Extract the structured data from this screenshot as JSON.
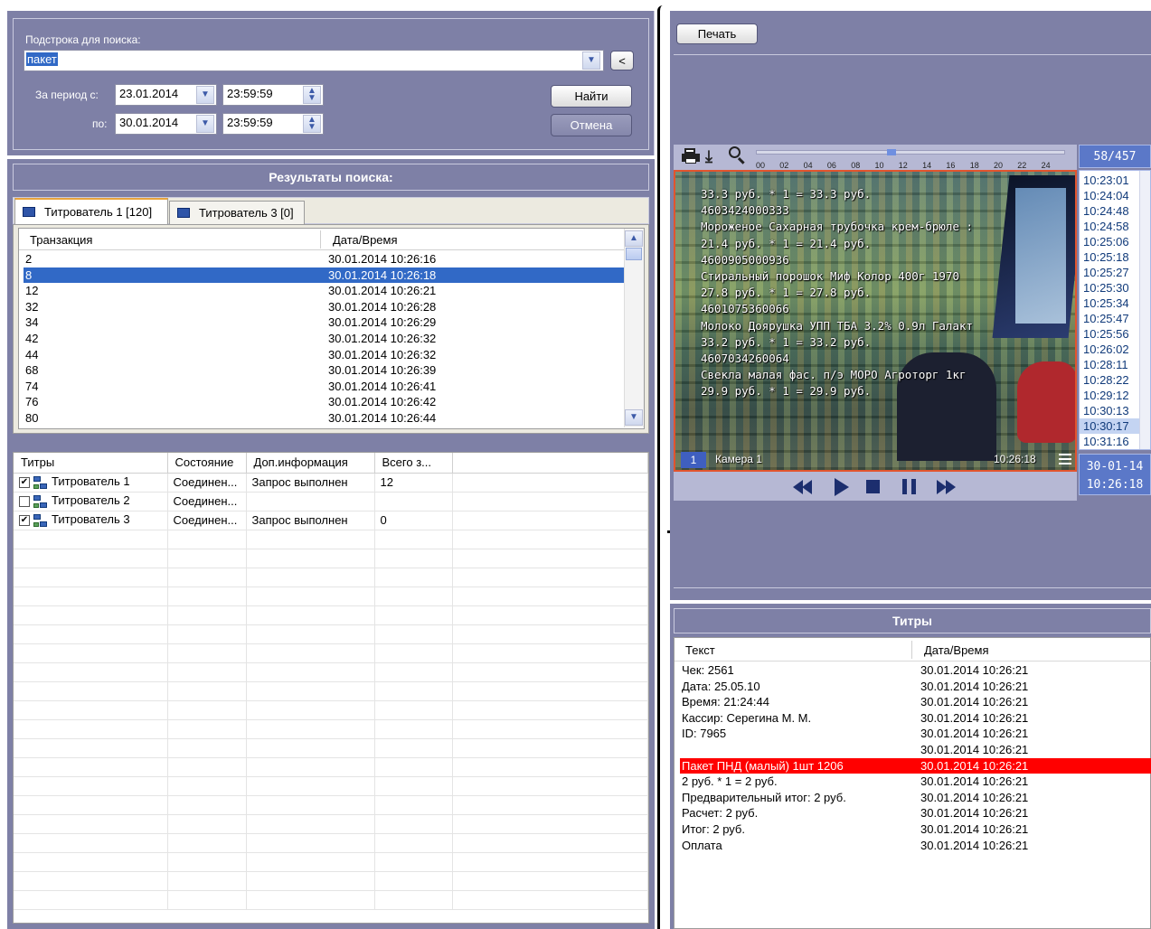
{
  "search": {
    "substring_label": "Подстрока для поиска:",
    "substring_value": "пакет",
    "back_symbol": "<",
    "period_from_label": "За период с:",
    "from_date": "23.01.2014",
    "from_time": "23:59:59",
    "period_to_label": "по:",
    "to_date": "30.01.2014",
    "to_time": "23:59:59",
    "find_label": "Найти",
    "cancel_label": "Отмена"
  },
  "results": {
    "header": "Результаты поиска:",
    "tabs": [
      {
        "label": "Титрователь 1 [120]"
      },
      {
        "label": "Титрователь 3 [0]"
      }
    ],
    "columns": [
      "Транзакция",
      "Дата/Время"
    ],
    "rows": [
      {
        "id": "2",
        "dt": "30.01.2014 10:26:16"
      },
      {
        "id": "8",
        "dt": "30.01.2014 10:26:18"
      },
      {
        "id": "12",
        "dt": "30.01.2014 10:26:21"
      },
      {
        "id": "32",
        "dt": "30.01.2014 10:26:28"
      },
      {
        "id": "34",
        "dt": "30.01.2014 10:26:29"
      },
      {
        "id": "42",
        "dt": "30.01.2014 10:26:32"
      },
      {
        "id": "44",
        "dt": "30.01.2014 10:26:32"
      },
      {
        "id": "68",
        "dt": "30.01.2014 10:26:39"
      },
      {
        "id": "74",
        "dt": "30.01.2014 10:26:41"
      },
      {
        "id": "76",
        "dt": "30.01.2014 10:26:42"
      },
      {
        "id": "80",
        "dt": "30.01.2014 10:26:44"
      }
    ],
    "selected_index": 1
  },
  "titrators": {
    "columns": [
      "Титры",
      "Состояние",
      "Доп.информация",
      "Всего з..."
    ],
    "rows": [
      {
        "checked": true,
        "name": "Титрователь 1",
        "state": "Соединен...",
        "info": "Запрос выполнен",
        "total": "12"
      },
      {
        "checked": false,
        "name": "Титрователь 2",
        "state": "Соединен...",
        "info": "",
        "total": ""
      },
      {
        "checked": true,
        "name": "Титрователь 3",
        "state": "Соединен...",
        "info": "Запрос выполнен",
        "total": "0"
      }
    ]
  },
  "player": {
    "print_label": "Печать",
    "counter": "58/457",
    "timeline_ticks": [
      "00",
      "02",
      "04",
      "06",
      "08",
      "10",
      "12",
      "14",
      "16",
      "18",
      "20",
      "22",
      "24"
    ],
    "timestamps": [
      "10:23:01",
      "10:24:04",
      "10:24:48",
      "10:24:58",
      "10:25:06",
      "10:25:18",
      "10:25:27",
      "10:25:30",
      "10:25:34",
      "10:25:47",
      "10:25:56",
      "10:26:02",
      "10:28:11",
      "10:28:22",
      "10:29:12",
      "10:30:13",
      "10:30:17",
      "10:31:16"
    ],
    "selected_timestamp_index": 16,
    "date_display": "30-01-14",
    "time_display": "10:26:18",
    "camera_number": "1",
    "camera_name": "Камера 1",
    "video_time": "10:26:18",
    "overlay_lines": [
      "33.3 руб. * 1 = 33.3 руб.",
      "4603424000333",
      "Мороженое Сахарная трубочка крем-брюле :",
      "21.4 руб. * 1 = 21.4 руб.",
      "4600905000936",
      "Стиральный порошок Миф Колор 400г 1970",
      "27.8 руб. * 1 = 27.8 руб.",
      "4601075360066",
      "Молоко Доярушка УПП ТБА 3.2% 0.9л Галакт",
      "33.2 руб. * 1 = 33.2 руб.",
      "4607034260064",
      "Свекла малая фас. п/э МОРО Агроторг 1кг",
      "29.9 руб. * 1 = 29.9 руб."
    ]
  },
  "titles": {
    "header": "Титры",
    "columns": [
      "Текст",
      "Дата/Время"
    ],
    "rows": [
      {
        "text": "Чек: 2561",
        "dt": "30.01.2014 10:26:21"
      },
      {
        "text": "Дата: 25.05.10",
        "dt": "30.01.2014 10:26:21"
      },
      {
        "text": "Время: 21:24:44",
        "dt": "30.01.2014 10:26:21"
      },
      {
        "text": "Кассир: Серегина М. М.",
        "dt": "30.01.2014 10:26:21"
      },
      {
        "text": "ID: 7965",
        "dt": "30.01.2014 10:26:21"
      },
      {
        "text": "",
        "dt": "30.01.2014 10:26:21"
      },
      {
        "text": "Пакет ПНД (малый) 1шт 1206",
        "dt": "30.01.2014 10:26:21"
      },
      {
        "text": " 2 руб. * 1 = 2 руб.",
        "dt": "30.01.2014 10:26:21"
      },
      {
        "text": "Предварительный итог: 2 руб.",
        "dt": "30.01.2014 10:26:21"
      },
      {
        "text": "Расчет: 2 руб.",
        "dt": "30.01.2014 10:26:21"
      },
      {
        "text": "Итог: 2 руб.",
        "dt": "30.01.2014 10:26:21"
      },
      {
        "text": "Оплата",
        "dt": "30.01.2014 10:26:21"
      }
    ],
    "highlight_index": 6
  },
  "colors": {
    "panel": "#7e80a6",
    "selection": "#3169c6",
    "highlight": "#ff0000"
  }
}
